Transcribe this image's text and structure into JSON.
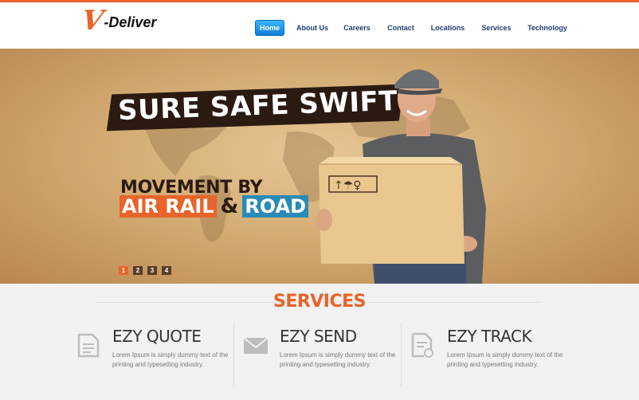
{
  "brand": {
    "logo_letter": "V",
    "logo_text": "-Deliver",
    "accent": "#e8642a"
  },
  "nav": {
    "items": [
      {
        "label": "Home",
        "active": true
      },
      {
        "label": "About Us"
      },
      {
        "label": "Careers"
      },
      {
        "label": "Contact"
      },
      {
        "label": "Locations"
      },
      {
        "label": "Services"
      },
      {
        "label": "Technology"
      }
    ]
  },
  "hero": {
    "slogan": "SURE SAFE SWIFT",
    "movement": "MOVEMENT BY",
    "mode_air_rail": "AIR RAIL",
    "mode_amp": "&",
    "mode_road": "ROAD",
    "slides": [
      "1",
      "2",
      "3",
      "4"
    ]
  },
  "services": {
    "title": "SERVICES",
    "items": [
      {
        "icon": "document-icon",
        "title": "EZY QUOTE",
        "desc": "Lorem Ipsum is simply dummy text of the printing and typesetting industry."
      },
      {
        "icon": "envelope-icon",
        "title": "EZY SEND",
        "desc": "Lorem Ipsum is simply dummy text of the printing and typesetting industry."
      },
      {
        "icon": "track-document-icon",
        "title": "EZY TRACK",
        "desc": "Lorem Ipsum is simply dummy text of the printing and typesetting industry."
      }
    ]
  }
}
